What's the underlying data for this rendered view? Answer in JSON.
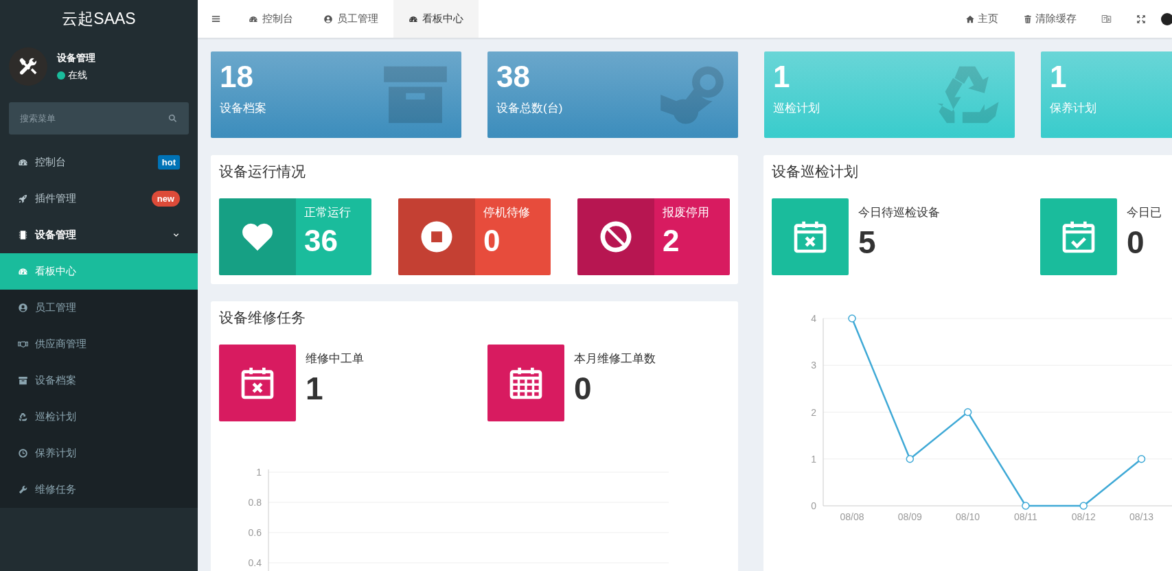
{
  "sidebar": {
    "logo": "云起SAAS",
    "user": {
      "name": "设备管理",
      "status": "在线"
    },
    "search": {
      "placeholder": "搜索菜单"
    },
    "menu": [
      {
        "label": "控制台",
        "selected": false,
        "badge": {
          "text": "hot",
          "color": "#0073b7",
          "kind": "square"
        }
      },
      {
        "label": "插件管理",
        "selected": false,
        "badge": {
          "text": "new",
          "color": "#dd4b39",
          "kind": "pill"
        }
      },
      {
        "label": "设备管理",
        "selected": false,
        "expanded": true,
        "children": [
          {
            "label": "看板中心",
            "selected": true
          },
          {
            "label": "员工管理",
            "selected": false
          },
          {
            "label": "供应商管理",
            "selected": false
          },
          {
            "label": "设备档案",
            "selected": false
          },
          {
            "label": "巡检计划",
            "selected": false
          },
          {
            "label": "保养计划",
            "selected": false
          },
          {
            "label": "维修任务",
            "selected": false
          }
        ]
      }
    ]
  },
  "header": {
    "tabs": [
      {
        "label": "控制台",
        "selected": false
      },
      {
        "label": "员工管理",
        "selected": false
      },
      {
        "label": "看板中心",
        "selected": true
      }
    ],
    "links": [
      "主页",
      "清除缓存"
    ]
  },
  "stat_cards": [
    {
      "value": "18",
      "label": "设备档案",
      "color": "#3c8dbc"
    },
    {
      "value": "38",
      "label": "设备总数(台)",
      "color": "#3c8dbc"
    },
    {
      "value": "1",
      "label": "巡检计划",
      "color": "#39cccc"
    },
    {
      "value": "1",
      "label": "保养计划",
      "color": "#39cccc"
    }
  ],
  "running_panel": {
    "title": "设备运行情况",
    "items": [
      {
        "label": "正常运行",
        "value": "36",
        "color": "#1abc9c"
      },
      {
        "label": "停机待修",
        "value": "0",
        "color": "#e74c3c"
      },
      {
        "label": "报废停用",
        "value": "2",
        "color": "#d81b60"
      }
    ]
  },
  "inspection_panel": {
    "title": "设备巡检计划",
    "items": [
      {
        "label": "今日待巡检设备",
        "value": "5",
        "color": "#1abc9c"
      },
      {
        "label": "今日已",
        "value": "0",
        "color": "#1abc9c"
      }
    ],
    "chart_data": {
      "type": "line",
      "categories": [
        "08/08",
        "08/09",
        "08/10",
        "08/11",
        "08/12",
        "08/13"
      ],
      "series": [
        {
          "color": "#3fa9d6",
          "marker": "circle",
          "values": [
            4,
            1,
            2,
            0,
            0,
            1
          ]
        }
      ],
      "grid": true,
      "ylim": [
        0,
        4
      ],
      "yticks": [
        0,
        1,
        2,
        3,
        4
      ]
    }
  },
  "repair_panel": {
    "title": "设备维修任务",
    "items": [
      {
        "label": "维修中工单",
        "value": "1",
        "color": "#d81b60"
      },
      {
        "label": "本月维修工单数",
        "value": "0",
        "color": "#d81b60"
      }
    ],
    "empty_plot": {
      "y_axis_labels": [
        "1",
        "0.8",
        "0.6",
        "0.4"
      ]
    }
  }
}
